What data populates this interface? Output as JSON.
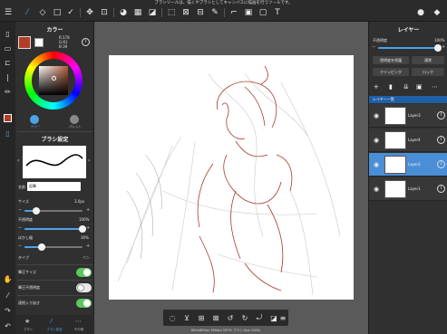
{
  "topbar": {
    "message": "ブラシツールは、描くやブラシとしてキャンバスに描画を行うツールです。",
    "icons": [
      "menu-icon",
      "brush-tool-icon",
      "eraser-tool-icon",
      "select-rect-icon",
      "pen-check-icon",
      "move-tool-icon",
      "transform-icon",
      "fill-icon",
      "gradation-icon",
      "paint-bucket-icon",
      "lasso-icon",
      "select-pen-icon",
      "select-eraser-icon",
      "magic-wand-icon",
      "eyedropper-icon",
      "dot-icon",
      "text-tool-icon",
      "chat-icon",
      "layers-icon"
    ]
  },
  "left_panel": {
    "color_title": "カラー",
    "rgb": {
      "r": "R:178",
      "g": "G:61",
      "b": "B:39"
    },
    "tab_color": "カラー",
    "tab_palette": "パレット",
    "brush_title": "ブラシ設定",
    "name_label": "名前",
    "name_value": "鉛筆",
    "size_label": "サイズ",
    "size_value": "3.0px",
    "size_pct": 20,
    "opacity_label": "不透明度",
    "opacity_value": "100%",
    "opacity_pct": 100,
    "blur_label": "ぼかし幅",
    "blur_value": "30%",
    "blur_pct": 30,
    "type_label": "タイプ",
    "type_value": "ペン",
    "pressure_size_label": "筆圧サイズ",
    "pressure_size_on": true,
    "pressure_opacity_label": "筆圧不透明度",
    "pressure_opacity_on": false,
    "stabilizer_label": "連続入り抜き",
    "stabilizer_on": true,
    "bottom_tabs": [
      "ブラシ",
      "ブラシ設定",
      "その他"
    ]
  },
  "canvas": {
    "status": "800x800px 350dpi 187% ブラシ:3px 100%"
  },
  "right_panel": {
    "layer_title": "レイヤー",
    "opacity_label": "不透明度",
    "opacity_value": "100%",
    "opacity_pct": 100,
    "protect_btn": "透明度を保護",
    "blend_btn": "通常",
    "clipping_btn": "クリッピング",
    "lock_btn": "ロック",
    "list_header": "レイヤー一覧",
    "layers": [
      {
        "name": "Layer3",
        "selected": false
      },
      {
        "name": "Layer4",
        "selected": false
      },
      {
        "name": "Layer2",
        "selected": true
      },
      {
        "name": "Layer1",
        "selected": false
      }
    ]
  },
  "colors": {
    "accent": "#4ea3e8",
    "current_color": "#b23d27",
    "toggle_on": "#5cc85c",
    "selected_layer": "#4a8ed6"
  }
}
